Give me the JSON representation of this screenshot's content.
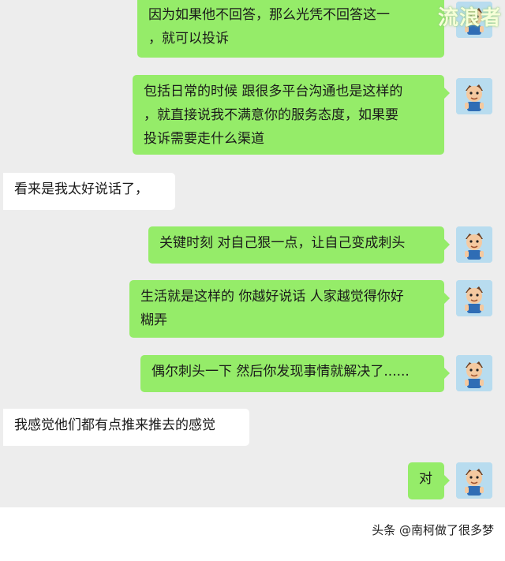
{
  "messages": [
    {
      "id": 1,
      "side": "me",
      "text": "因为如果他不回答，那么光凭不回答这一\n，就可以投诉"
    },
    {
      "id": 2,
      "side": "me",
      "text": "包括日常的时候 跟很多平台沟通也是这样的\n，就直接说我不满意你的服务态度，如果要\n投诉需要走什么渠道"
    },
    {
      "id": 3,
      "side": "other",
      "text": "看来是我太好说话了，"
    },
    {
      "id": 4,
      "side": "me",
      "text": "关键时刻 对自己狠一点，让自己变成刺头"
    },
    {
      "id": 5,
      "side": "me",
      "text": "生活就是这样的 你越好说话 人家越觉得你好\n糊弄"
    },
    {
      "id": 6,
      "side": "me",
      "text": "偶尔刺头一下 然后你发现事情就解决了......"
    },
    {
      "id": 7,
      "side": "other",
      "text": "我感觉他们都有点推来推去的感觉"
    },
    {
      "id": 8,
      "side": "me",
      "text": "对"
    }
  ],
  "logo_text": "流浪者",
  "watermark": "头条 @南柯做了很多梦",
  "colors": {
    "chat_background": "#ededed",
    "my_bubble": "#95ec69",
    "their_bubble": "#ffffff",
    "avatar_background": "#b8dcef"
  },
  "avatar_icon": "cartoon-boy-avatar-icon"
}
